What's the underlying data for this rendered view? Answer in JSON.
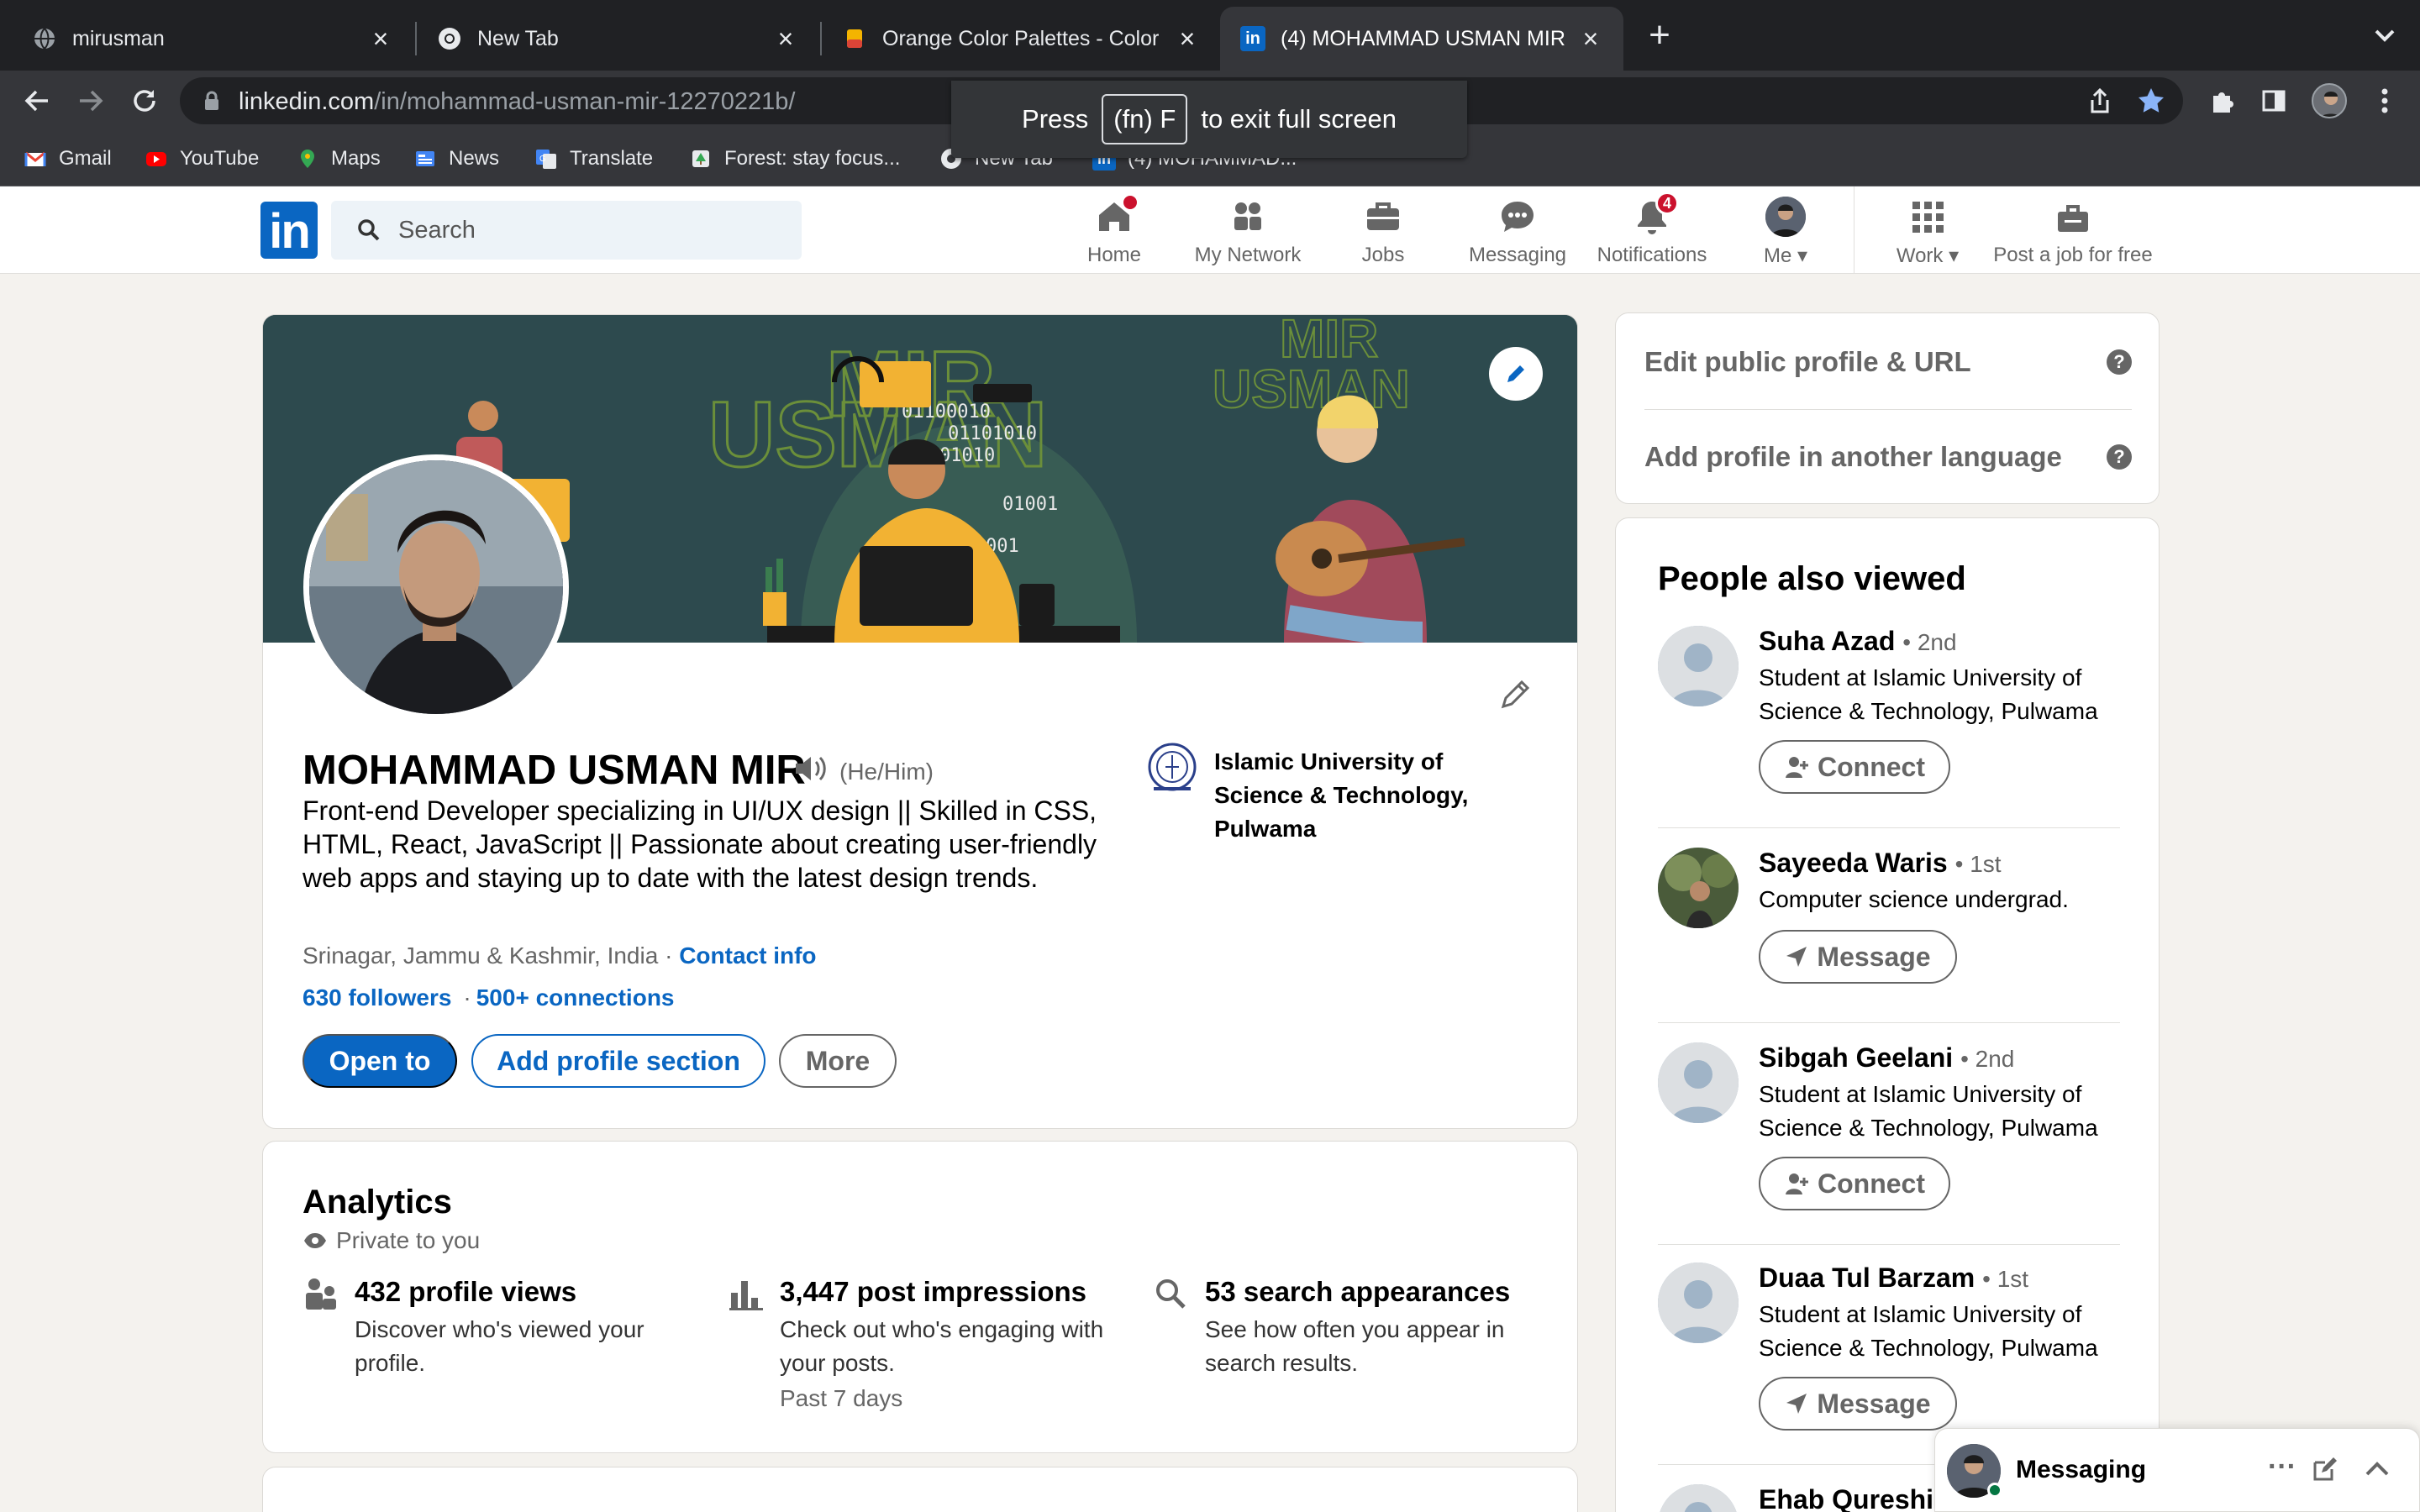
{
  "browser": {
    "tabs": [
      {
        "title": "mirusman",
        "active": false
      },
      {
        "title": "New Tab",
        "active": false
      },
      {
        "title": "Orange Color Palettes - Color I",
        "active": false
      },
      {
        "title": "(4) MOHAMMAD USMAN MIR |",
        "active": true
      }
    ],
    "new_tab_symbol": "+",
    "url_host": "linkedin.com",
    "url_path": "/in/mohammad-usman-mir-12270221b/",
    "bookmarks": [
      "Gmail",
      "YouTube",
      "Maps",
      "News",
      "Translate",
      "Forest: stay focus...",
      "New Tab",
      "(4) MOHAMMAD..."
    ],
    "fullscreen_toast": {
      "press": "Press",
      "key": "(fn) F",
      "suffix": "to exit full screen"
    }
  },
  "nav": {
    "search_placeholder": "Search",
    "items": [
      {
        "label": "Home",
        "icon": "home-icon",
        "badge": ""
      },
      {
        "label": "My Network",
        "icon": "network-icon",
        "badge": ""
      },
      {
        "label": "Jobs",
        "icon": "briefcase-icon",
        "badge": ""
      },
      {
        "label": "Messaging",
        "icon": "messaging-icon",
        "badge": ""
      },
      {
        "label": "Notifications",
        "icon": "bell-icon",
        "badge": "4"
      },
      {
        "label": "Me",
        "icon": "avatar",
        "badge": ""
      },
      {
        "label": "Work",
        "icon": "grid-icon",
        "badge": ""
      },
      {
        "label": "Post a job for free",
        "icon": "post-job-icon",
        "badge": ""
      }
    ]
  },
  "profile": {
    "name": "MOHAMMAD USMAN MIR",
    "pronouns": "(He/Him)",
    "headline": "Front-end Developer specializing in UI/UX design || Skilled in CSS, HTML, React, JavaScript || Passionate about creating user-friendly web apps and staying up to date with the latest design trends.",
    "location": "Srinagar, Jammu & Kashmir, India",
    "location_sep": "·",
    "contact_info": "Contact info",
    "followers": "630 followers",
    "connections": "500+ connections",
    "school": "Islamic University of Science & Technology, Pulwama",
    "buttons": {
      "open_to": "Open to",
      "add_section": "Add profile section",
      "more": "More"
    },
    "banner_text": {
      "word1": "MIR",
      "word2": "USMAN",
      "binary1": "01100010",
      "binary2": "01101010",
      "binary3": "01010",
      "binary4": "01001",
      "binary5": "001"
    }
  },
  "analytics": {
    "title": "Analytics",
    "privacy": "Private to you",
    "stats": [
      {
        "title": "432 profile views",
        "desc": "Discover who's viewed your profile.",
        "sub": ""
      },
      {
        "title": "3,447 post impressions",
        "desc": "Check out who's engaging with your posts.",
        "sub": "Past 7 days"
      },
      {
        "title": "53 search appearances",
        "desc": "See how often you appear in search results.",
        "sub": ""
      }
    ]
  },
  "sidebar": {
    "edit_url": "Edit public profile & URL",
    "add_language": "Add profile in another language",
    "help": "?",
    "people_title": "People also viewed",
    "people": [
      {
        "name": "Suha Azad",
        "degree": "• 2nd",
        "sub": "Student at Islamic University of Science & Technology, Pulwama",
        "button": "Connect"
      },
      {
        "name": "Sayeeda Waris",
        "degree": "• 1st",
        "sub": "Computer science undergrad.",
        "button": "Message"
      },
      {
        "name": "Sibgah Geelani",
        "degree": "• 2nd",
        "sub": "Student at Islamic University of Science & Technology, Pulwama",
        "button": "Connect"
      },
      {
        "name": "Duaa Tul Barzam",
        "degree": "• 1st",
        "sub": "Student at Islamic University of Science & Technology, Pulwama",
        "button": "Message"
      },
      {
        "name": "Ehab Qureshi",
        "degree": "",
        "sub": "",
        "button": ""
      }
    ]
  },
  "messaging": {
    "label": "Messaging",
    "more": "···"
  },
  "colors": {
    "linkedin_blue": "#0a66c2",
    "badge_red": "#cb112d",
    "online_green": "#057642",
    "banner_teal": "#2d4a4e"
  }
}
